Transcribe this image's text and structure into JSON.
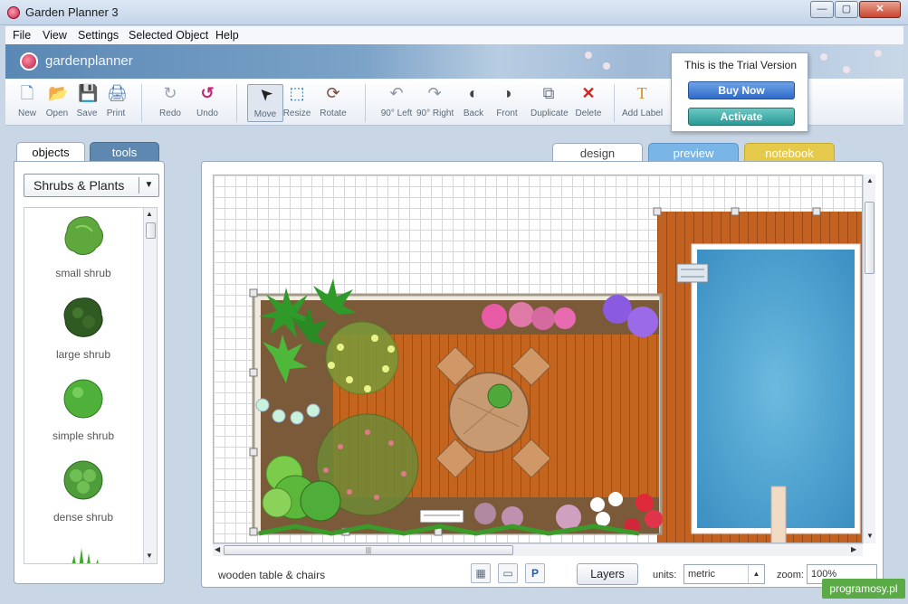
{
  "window": {
    "title": "Garden Planner 3",
    "min": "—",
    "max": "▢",
    "close": "✕"
  },
  "menu": [
    "File",
    "View",
    "Settings",
    "Selected Object",
    "Help"
  ],
  "brand": {
    "name": "gardenplanner"
  },
  "toolbar": {
    "items": [
      {
        "label": "New",
        "icon": "new-file-icon",
        "glyph": "🗋"
      },
      {
        "label": "Open",
        "icon": "open-folder-icon",
        "glyph": "📂"
      },
      {
        "label": "Save",
        "icon": "save-icon",
        "glyph": "💾"
      },
      {
        "label": "Print",
        "icon": "print-icon",
        "glyph": "🖨"
      },
      {
        "label": "Redo",
        "icon": "redo-icon",
        "glyph": "↻"
      },
      {
        "label": "Undo",
        "icon": "undo-icon",
        "glyph": "↺"
      },
      {
        "label": "Move",
        "icon": "cursor-icon",
        "glyph": "➤"
      },
      {
        "label": "Resize",
        "icon": "resize-icon",
        "glyph": "⬚"
      },
      {
        "label": "Rotate",
        "icon": "rotate-icon",
        "glyph": "⟳"
      },
      {
        "label": "90° Left",
        "icon": "rotate-left-icon",
        "glyph": "↶"
      },
      {
        "label": "90° Right",
        "icon": "rotate-right-icon",
        "glyph": "↷"
      },
      {
        "label": "Back",
        "icon": "send-back-icon",
        "glyph": "◐"
      },
      {
        "label": "Front",
        "icon": "bring-front-icon",
        "glyph": "◑"
      },
      {
        "label": "Duplicate",
        "icon": "duplicate-icon",
        "glyph": "⧉"
      },
      {
        "label": "Delete",
        "icon": "delete-icon",
        "glyph": "✕"
      },
      {
        "label": "Add Label",
        "icon": "text-label-icon",
        "glyph": "T"
      }
    ]
  },
  "trial": {
    "message": "This is the Trial Version",
    "buy": "Buy Now",
    "activate": "Activate"
  },
  "left_panel": {
    "tabs": [
      "objects",
      "tools"
    ],
    "category": "Shrubs & Plants",
    "objects": [
      {
        "name": "small shrub",
        "color": "#5fa83d"
      },
      {
        "name": "large shrub",
        "color": "#2f5a22"
      },
      {
        "name": "simple shrub",
        "color": "#4fb13a"
      },
      {
        "name": "dense shrub",
        "color": "#4f9d3a"
      }
    ]
  },
  "view_tabs": [
    "design",
    "preview",
    "notebook"
  ],
  "status": {
    "selected": "wooden table & chairs",
    "layers": "Layers",
    "units_label": "units:",
    "units_value": "metric",
    "zoom_label": "zoom:",
    "zoom_value": "100%",
    "p_icon": "P"
  },
  "watermark": "programosy.pl",
  "colors": {
    "deck": "#c4651f",
    "pool": "#4aa0d0",
    "soil": "#7a5a38",
    "grass": "#4fa83a"
  }
}
